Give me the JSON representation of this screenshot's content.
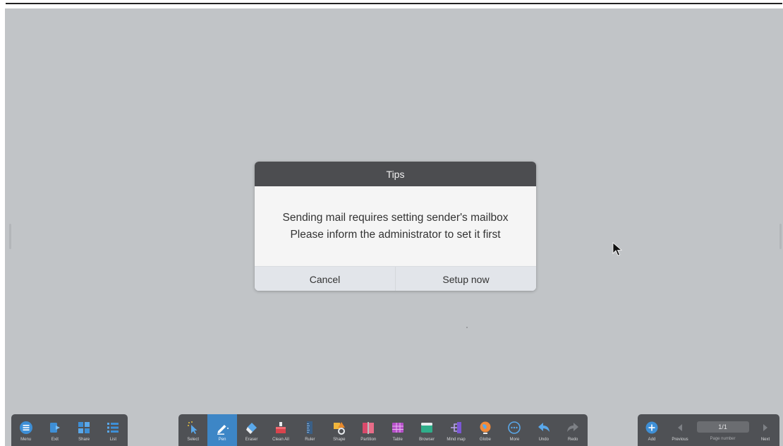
{
  "dialog": {
    "title": "Tips",
    "message_line1": "Sending mail requires setting sender's mailbox",
    "message_line2": "Please inform the administrator to set it first",
    "cancel_label": "Cancel",
    "setup_label": "Setup now"
  },
  "toolbar_left": [
    {
      "label": "Menu",
      "icon": "menu-icon"
    },
    {
      "label": "Exit",
      "icon": "exit-icon"
    },
    {
      "label": "Share",
      "icon": "share-icon"
    },
    {
      "label": "List",
      "icon": "list-icon"
    }
  ],
  "toolbar_center": [
    {
      "label": "Select",
      "icon": "select-icon"
    },
    {
      "label": "Pen",
      "icon": "pen-icon",
      "active": true
    },
    {
      "label": "Eraser",
      "icon": "eraser-icon"
    },
    {
      "label": "Clean All",
      "icon": "clean-all-icon"
    },
    {
      "label": "Ruler",
      "icon": "ruler-icon"
    },
    {
      "label": "Shape",
      "icon": "shape-icon"
    },
    {
      "label": "Partition",
      "icon": "partition-icon"
    },
    {
      "label": "Table",
      "icon": "table-icon"
    },
    {
      "label": "Browser",
      "icon": "browser-icon"
    },
    {
      "label": "Mind map",
      "icon": "mind-map-icon"
    },
    {
      "label": "Globe",
      "icon": "globe-icon"
    },
    {
      "label": "More",
      "icon": "more-icon"
    },
    {
      "label": "Undo",
      "icon": "undo-icon"
    },
    {
      "label": "Redo",
      "icon": "redo-icon"
    }
  ],
  "toolbar_right": {
    "add_label": "Add",
    "previous_label": "Previous",
    "page_value": "1/1",
    "page_number_label": "Page number",
    "next_label": "Next"
  },
  "colors": {
    "canvas": "#c1c4c7",
    "toolbar": "#4f5155",
    "accent": "#3d86c6",
    "dialog_header": "#4c4d50"
  }
}
